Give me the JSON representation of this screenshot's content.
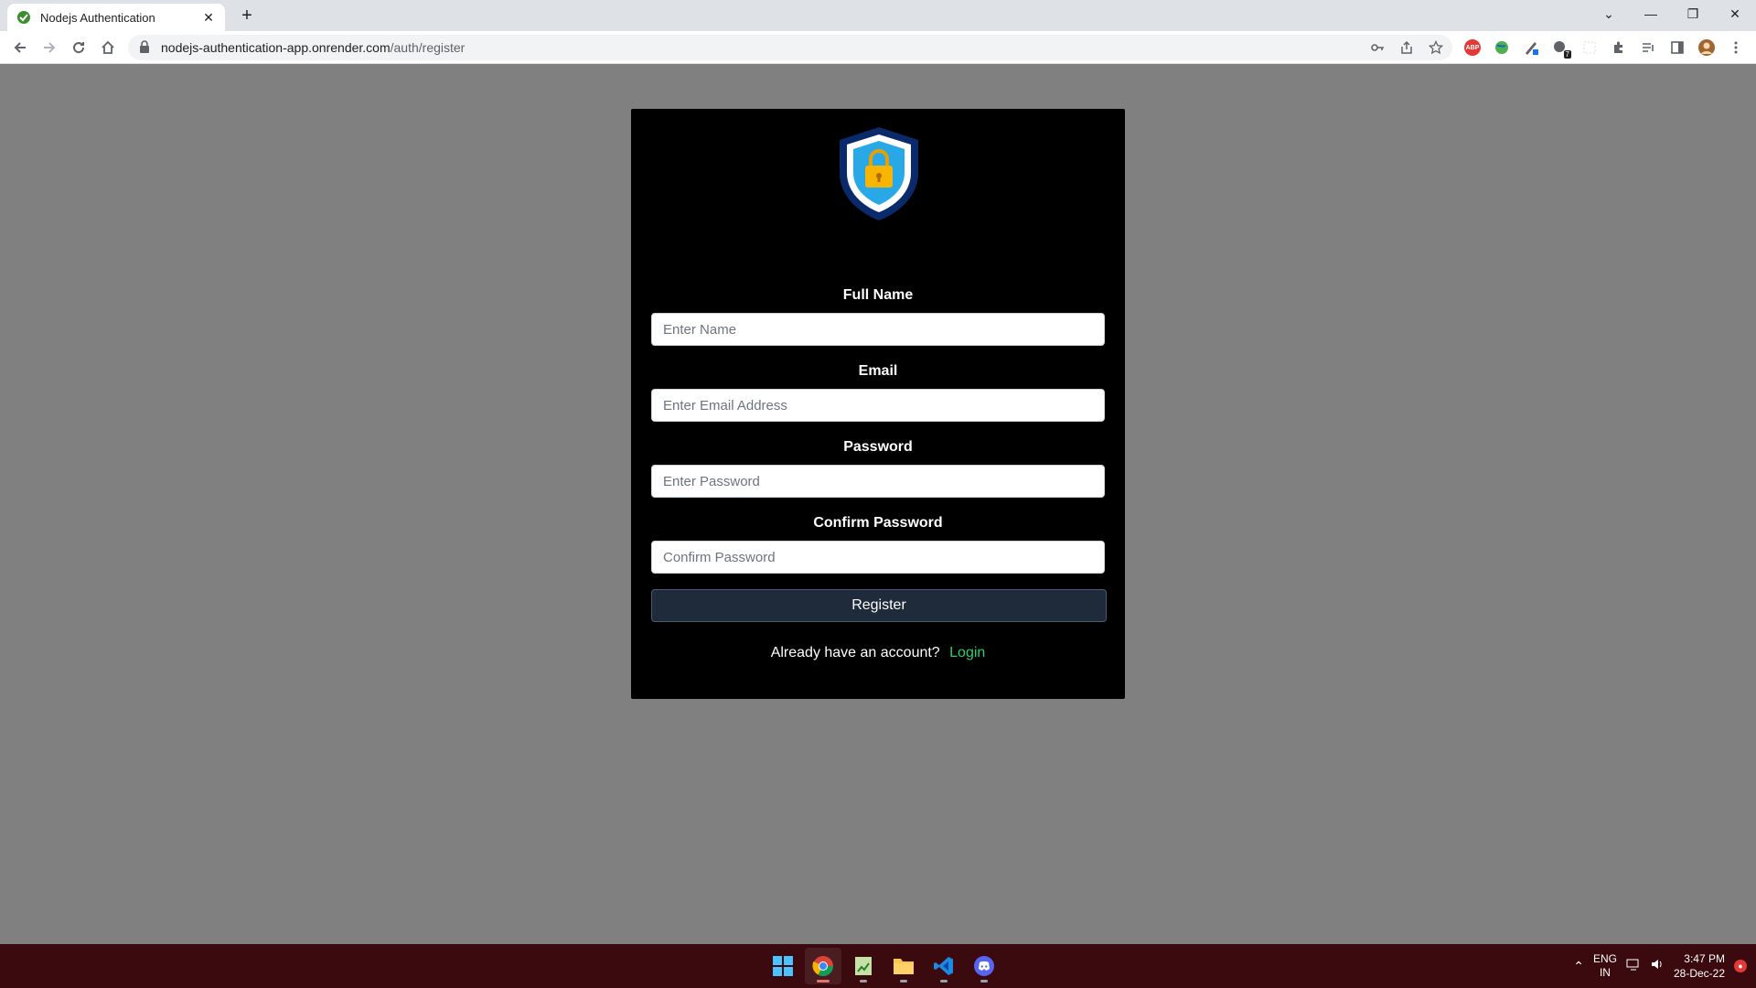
{
  "browser": {
    "tab_title": "Nodejs Authentication",
    "url_host": "nodejs-authentication-app.onrender.com",
    "url_path": "/auth/register",
    "extensions": [
      "abp-icon",
      "world-icon",
      "pen-icon",
      "extension-badge-icon",
      "blank-icon",
      "puzzle-icon",
      "media-icon",
      "sidepanel-icon",
      "profile-avatar",
      "menu-icon"
    ],
    "ext_badge_count": "7",
    "abp_label": "ABP"
  },
  "form": {
    "name_label": "Full Name",
    "name_placeholder": "Enter Name",
    "email_label": "Email",
    "email_placeholder": "Enter Email Address",
    "password_label": "Password",
    "password_placeholder": "Enter Password",
    "confirm_label": "Confirm Password",
    "confirm_placeholder": "Confirm Password",
    "register_label": "Register",
    "signin_text": "Already have an account?",
    "login_link": "Login"
  },
  "taskbar": {
    "lang_top": "ENG",
    "lang_bottom": "IN",
    "time": "3:47 PM",
    "date": "28-Dec-22"
  },
  "colors": {
    "page_bg": "#808080",
    "card_bg": "#000000",
    "button_bg": "#1f2a3a",
    "link": "#2ecc71",
    "taskbar": "#3b0a0e"
  }
}
